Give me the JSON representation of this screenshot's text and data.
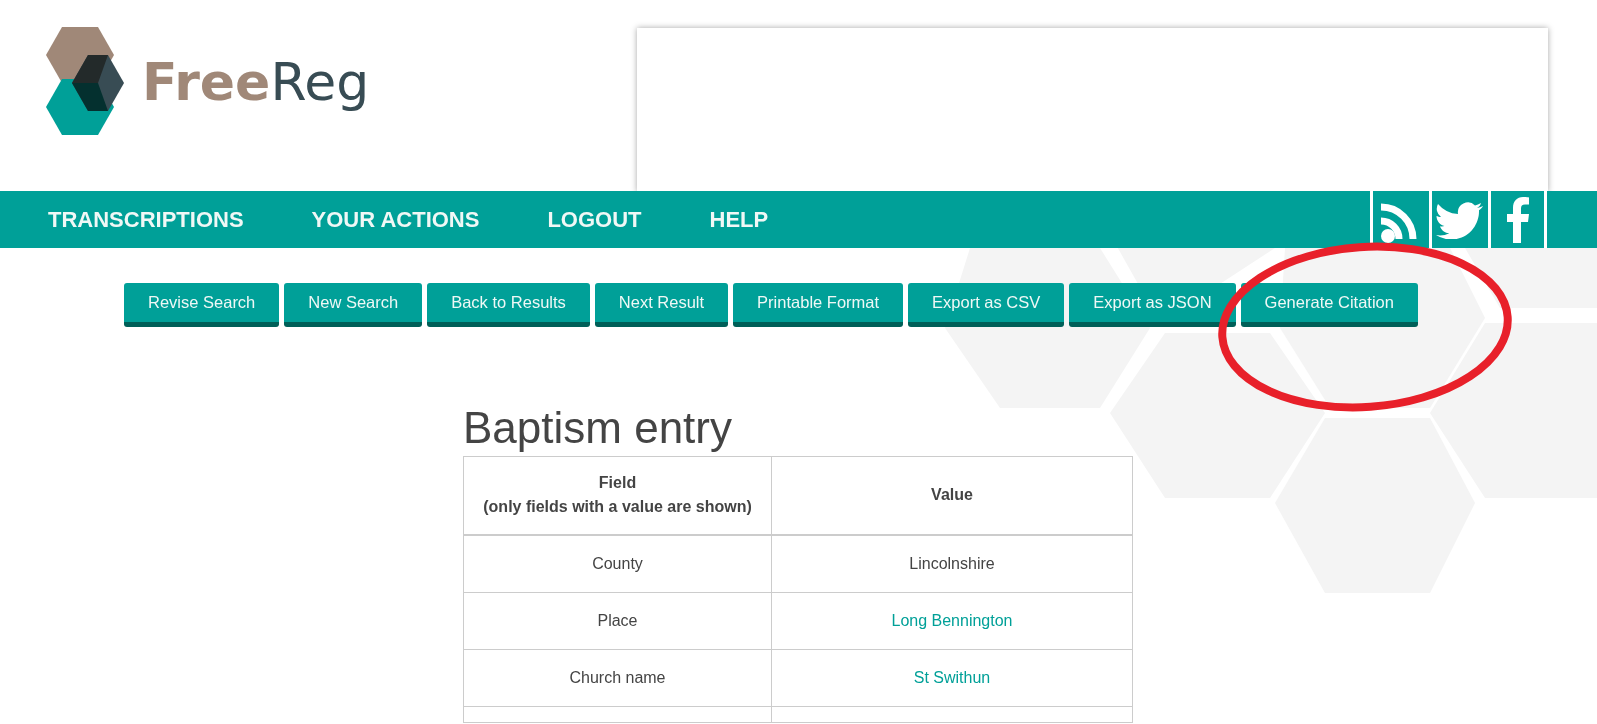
{
  "logo": {
    "parts": [
      "Free",
      "Reg"
    ]
  },
  "nav": {
    "items": [
      "TRANSCRIPTIONS",
      "YOUR ACTIONS",
      "LOGOUT",
      "HELP"
    ]
  },
  "actions": [
    "Revise Search",
    "New Search",
    "Back to Results",
    "Next Result",
    "Printable Format",
    "Export as CSV",
    "Export as JSON",
    "Generate Citation"
  ],
  "heading": "Baptism entry",
  "table": {
    "columns": [
      {
        "lines": [
          "Field",
          "(only fields with a value are shown)"
        ]
      },
      {
        "lines": [
          "Value"
        ]
      }
    ],
    "rows": [
      {
        "field": "County",
        "value": "Lincolnshire",
        "link": false
      },
      {
        "field": "Place",
        "value": "Long Bennington",
        "link": true
      },
      {
        "field": "Church name",
        "value": "St Swithun",
        "link": true
      }
    ]
  }
}
